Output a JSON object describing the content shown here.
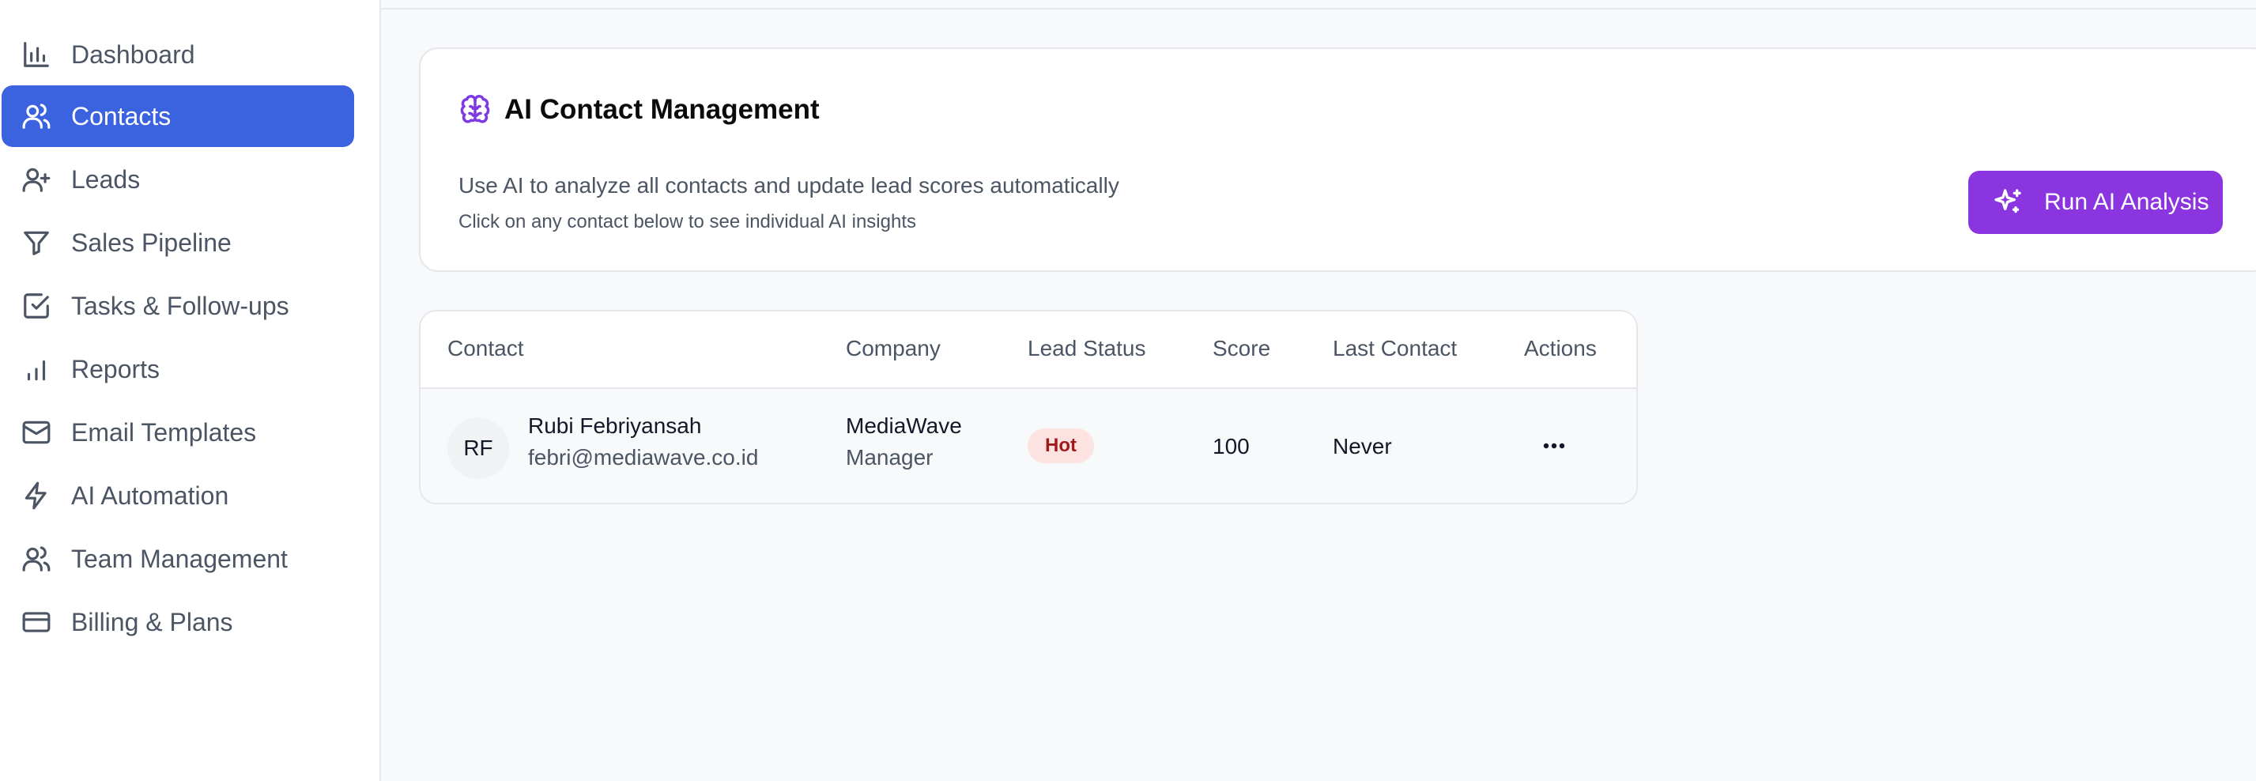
{
  "sidebar": {
    "items": [
      {
        "label": "Dashboard",
        "icon": "bar-chart-icon",
        "active": false
      },
      {
        "label": "Contacts",
        "icon": "users-icon",
        "active": true
      },
      {
        "label": "Leads",
        "icon": "user-plus-icon",
        "active": false
      },
      {
        "label": "Sales Pipeline",
        "icon": "filter-icon",
        "active": false
      },
      {
        "label": "Tasks & Follow-ups",
        "icon": "check-square-icon",
        "active": false
      },
      {
        "label": "Reports",
        "icon": "bar-chart-2-icon",
        "active": false
      },
      {
        "label": "Email Templates",
        "icon": "mail-icon",
        "active": false
      },
      {
        "label": "AI Automation",
        "icon": "zap-icon",
        "active": false
      },
      {
        "label": "Team Management",
        "icon": "users-icon",
        "active": false
      },
      {
        "label": "Billing & Plans",
        "icon": "credit-card-icon",
        "active": false
      }
    ]
  },
  "ai_card": {
    "icon": "brain-icon",
    "title": "AI Contact Management",
    "description": "Use AI to analyze all contacts and update lead scores automatically",
    "hint": "Click on any contact below to see individual AI insights",
    "button_label": "Run AI Analysis",
    "button_icon": "sparkles-icon"
  },
  "table": {
    "columns": [
      "Contact",
      "Company",
      "Lead Status",
      "Score",
      "Last Contact",
      "Actions"
    ],
    "rows": [
      {
        "initials": "RF",
        "name": "Rubi Febriyansah",
        "email": "febri@mediawave.co.id",
        "company": "MediaWave",
        "role": "Manager",
        "status": "Hot",
        "score": "100",
        "last_contact": "Never",
        "actions_icon": "more-horizontal-icon"
      }
    ]
  },
  "colors": {
    "accent_blue": "#3b63e0",
    "accent_purple": "#8a35e0",
    "hot_badge_bg": "#fde2e2",
    "hot_badge_text": "#a01b1b"
  }
}
